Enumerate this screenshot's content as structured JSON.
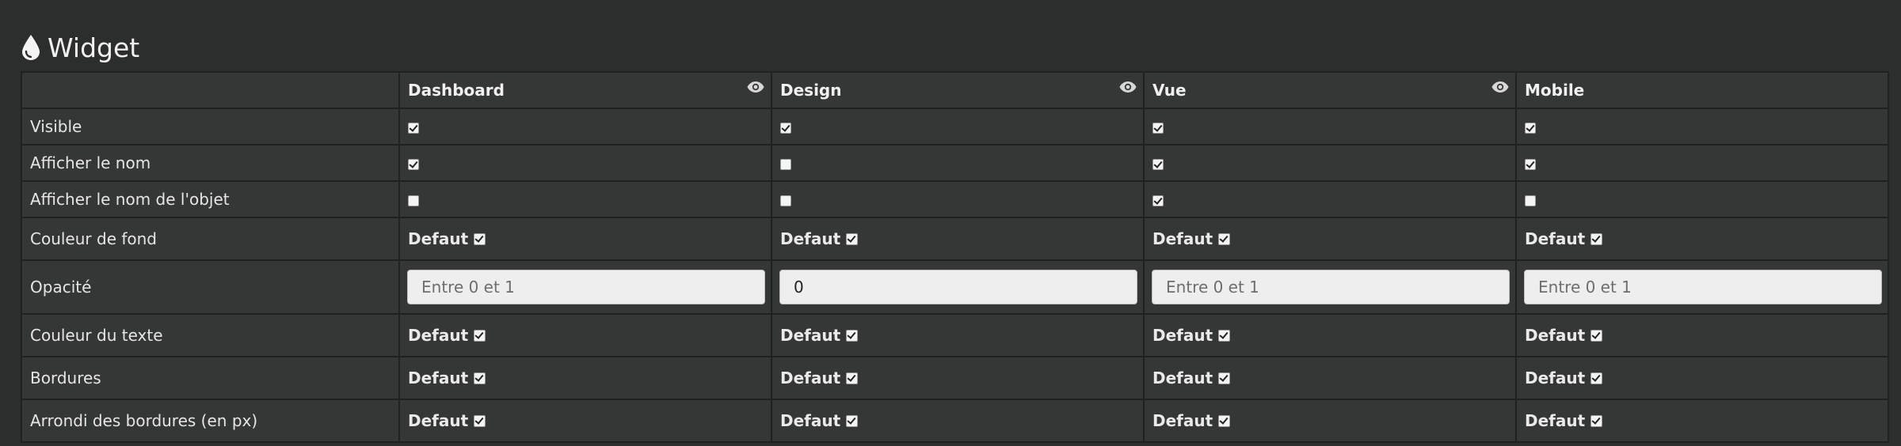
{
  "section": {
    "title": "Widget",
    "icon": "droplet-icon"
  },
  "columns": [
    {
      "label": "Dashboard",
      "has_eye": true
    },
    {
      "label": "Design",
      "has_eye": true
    },
    {
      "label": "Vue",
      "has_eye": true
    },
    {
      "label": "Mobile",
      "has_eye": false
    }
  ],
  "rows": {
    "visible": {
      "label": "Visible",
      "values": [
        true,
        true,
        true,
        true
      ]
    },
    "show_name": {
      "label": "Afficher le nom",
      "values": [
        true,
        false,
        true,
        true
      ]
    },
    "show_object_name": {
      "label": "Afficher le nom de l'objet",
      "values": [
        false,
        false,
        true,
        false
      ]
    },
    "bg_color": {
      "label": "Couleur de fond",
      "default_label": "Defaut",
      "values": [
        true,
        true,
        true,
        true
      ]
    },
    "opacity": {
      "label": "Opacité",
      "placeholder": "Entre 0 et 1",
      "values": [
        "",
        "0",
        "",
        ""
      ]
    },
    "text_color": {
      "label": "Couleur du texte",
      "default_label": "Defaut",
      "values": [
        true,
        true,
        true,
        true
      ]
    },
    "borders": {
      "label": "Bordures",
      "default_label": "Defaut",
      "values": [
        true,
        true,
        true,
        true
      ]
    },
    "border_radius": {
      "label": "Arrondi des bordures (en px)",
      "default_label": "Defaut",
      "values": [
        true,
        true,
        true,
        true
      ]
    }
  },
  "colors": {
    "background": "#2c2d2d",
    "cell": "#353636",
    "border": "#1f2020",
    "text": "#e6e6e6"
  }
}
